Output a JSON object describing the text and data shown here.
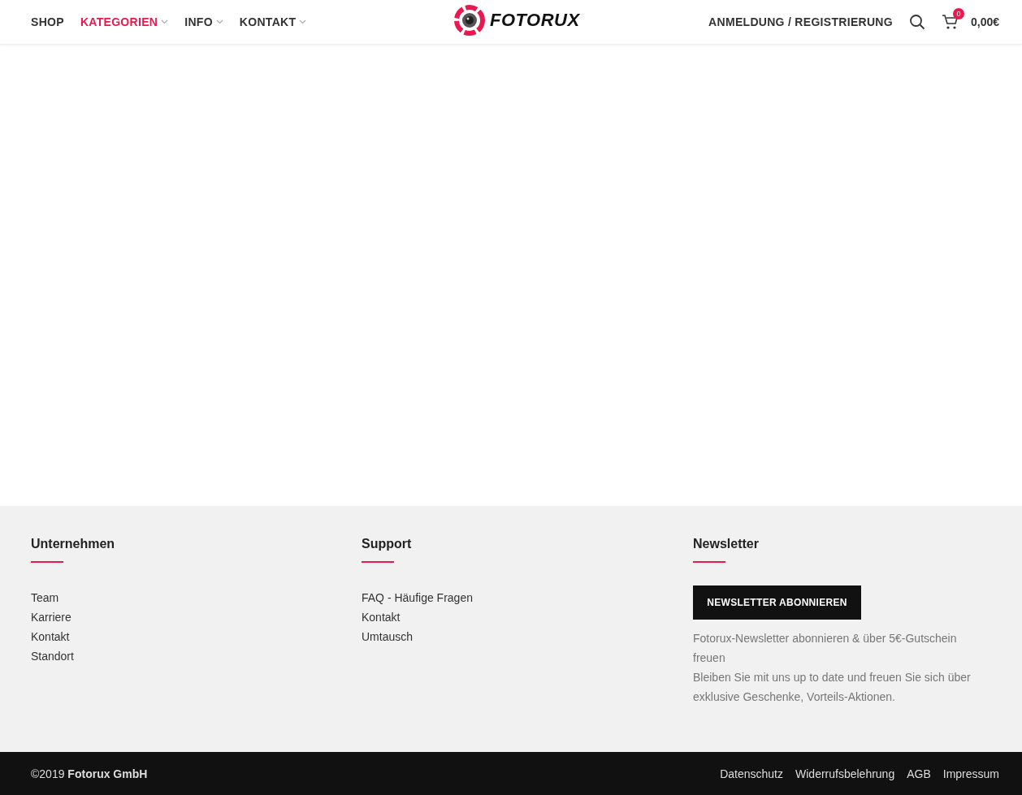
{
  "header": {
    "nav": [
      {
        "label": "SHOP",
        "selected": false,
        "dropdown": false
      },
      {
        "label": "KATEGORIEN",
        "selected": true,
        "dropdown": true
      },
      {
        "label": "INFO",
        "selected": false,
        "dropdown": true
      },
      {
        "label": "KONTAKT",
        "selected": false,
        "dropdown": true
      }
    ],
    "logo": "FOTORUX",
    "account": "ANMELDUNG / REGISTRIERUNG",
    "cart_count": "0",
    "cart_total": "0,00€"
  },
  "footer": {
    "columns": [
      {
        "title": "Unternehmen",
        "links": [
          "Team",
          "Karriere",
          "Kontakt",
          "Standort"
        ]
      },
      {
        "title": "Support",
        "links": [
          "FAQ - Häufige Fragen",
          "Kontakt",
          "Umtausch"
        ]
      }
    ],
    "newsletter": {
      "title": "Newsletter",
      "button": "NEWSLETTER ABONNIEREN",
      "paragraphs": [
        "Fotorux-Newsletter abonnieren & über 5€-Gutschein freuen",
        "Bleiben Sie mit uns up to date und freuen Sie sich über exklusive Geschenke, Vorteils-Aktionen."
      ]
    }
  },
  "bottom_bar": {
    "copyright": "©2019 **Fotorux GmbH**",
    "links": [
      "Datenschutz",
      "Widerrufsbelehrung",
      "AGB",
      "Impressum"
    ]
  }
}
